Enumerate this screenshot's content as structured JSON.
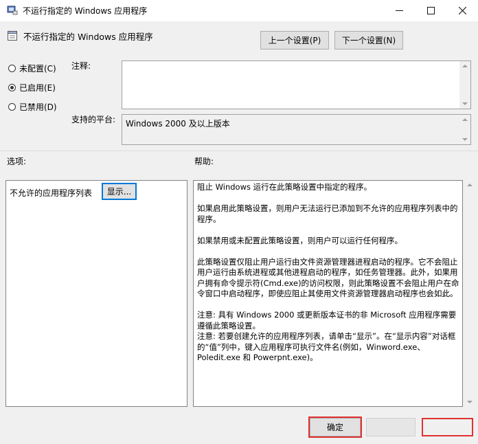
{
  "window": {
    "title": "不运行指定的 Windows 应用程序",
    "minimize_icon": "minimize-icon",
    "maximize_icon": "maximize-icon",
    "close_icon": "close-icon"
  },
  "header": {
    "setting_title": "不运行指定的 Windows 应用程序",
    "prev_button": "上一个设置(P)",
    "next_button": "下一个设置(N)"
  },
  "state": {
    "options": [
      {
        "label": "未配置(C)",
        "selected": false
      },
      {
        "label": "已启用(E)",
        "selected": true
      },
      {
        "label": "已禁用(D)",
        "selected": false
      }
    ]
  },
  "comment": {
    "label": "注释:",
    "value": ""
  },
  "platform": {
    "label": "支持的平台:",
    "value": "Windows 2000 及以上版本"
  },
  "options_section": {
    "label": "选项:",
    "disallowed_list_label": "不允许的应用程序列表",
    "show_button": "显示..."
  },
  "help_section": {
    "label": "帮助:",
    "paragraphs": [
      "阻止 Windows 运行在此策略设置中指定的程序。",
      "如果启用此策略设置，则用户无法运行已添加到不允许的应用程序列表中的程序。",
      "如果禁用或未配置此策略设置，则用户可以运行任何程序。",
      "此策略设置仅阻止用户运行由文件资源管理器进程启动的程序。它不会阻止用户运行由系统进程或其他进程启动的程序，如任务管理器。此外，如果用户拥有命令提示符(Cmd.exe)的访问权限，则此策略设置不会阻止用户在命令窗口中启动程序，即使应阻止其使用文件资源管理器启动程序也会如此。",
      "注意: 具有 Windows 2000 或更新版本证书的非 Microsoft 应用程序需要遵循此策略设置。",
      "注意: 若要创建允许的应用程序列表，请单击“显示”。在“显示内容”对话框的“值”列中，键入应用程序可执行文件名(例如，Winword.exe、Poledit.exe 和 Powerpnt.exe)。"
    ]
  },
  "footer": {
    "ok_button": "确定",
    "cancel_button": "",
    "apply_button": ""
  },
  "colors": {
    "focus_blue": "#0078d7",
    "highlight_red": "#e03030"
  }
}
